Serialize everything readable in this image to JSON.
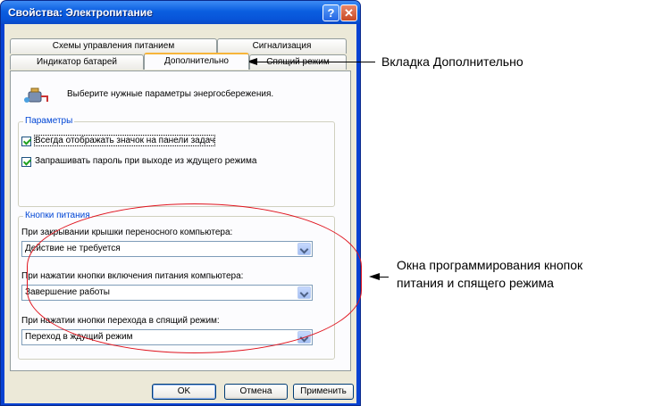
{
  "window": {
    "title": "Свойства: Электропитание",
    "help_label": "?",
    "close_label": "✕"
  },
  "tabs": {
    "row1": [
      "Схемы управления питанием",
      "Сигнализация"
    ],
    "row2": [
      "Индикатор батарей",
      "Дополнительно",
      "Спящий режим"
    ],
    "active": "Дополнительно"
  },
  "panel": {
    "banner_icon": "battery-plug-icon",
    "banner_text": "Выберите нужные параметры энергосбережения.",
    "parameters": {
      "legend": "Параметры",
      "checkboxes": [
        {
          "label": "Всегда отображать значок на панели задач",
          "checked": true
        },
        {
          "label": "Запрашивать пароль при выходе из ждущего режима",
          "checked": true
        }
      ]
    },
    "power_buttons": {
      "legend": "Кнопки питания",
      "fields": [
        {
          "label": "При закрывании крышки переносного компьютера:",
          "value": "Действие не требуется"
        },
        {
          "label": "При нажатии кнопки включения питания компьютера:",
          "value": "Завершение работы"
        },
        {
          "label": "При нажатии кнопки перехода в спящий режим:",
          "value": "Переход в ждущий режим"
        }
      ]
    }
  },
  "buttons": {
    "ok": "OK",
    "cancel": "Отмена",
    "apply": "Применить"
  },
  "annotations": {
    "tab_callout": "Вкладка Дополнительно",
    "buttons_callout_line1": "Окна программирования кнопок",
    "buttons_callout_line2": "питания и спящего режима",
    "highlight_color": "#e0141e"
  }
}
